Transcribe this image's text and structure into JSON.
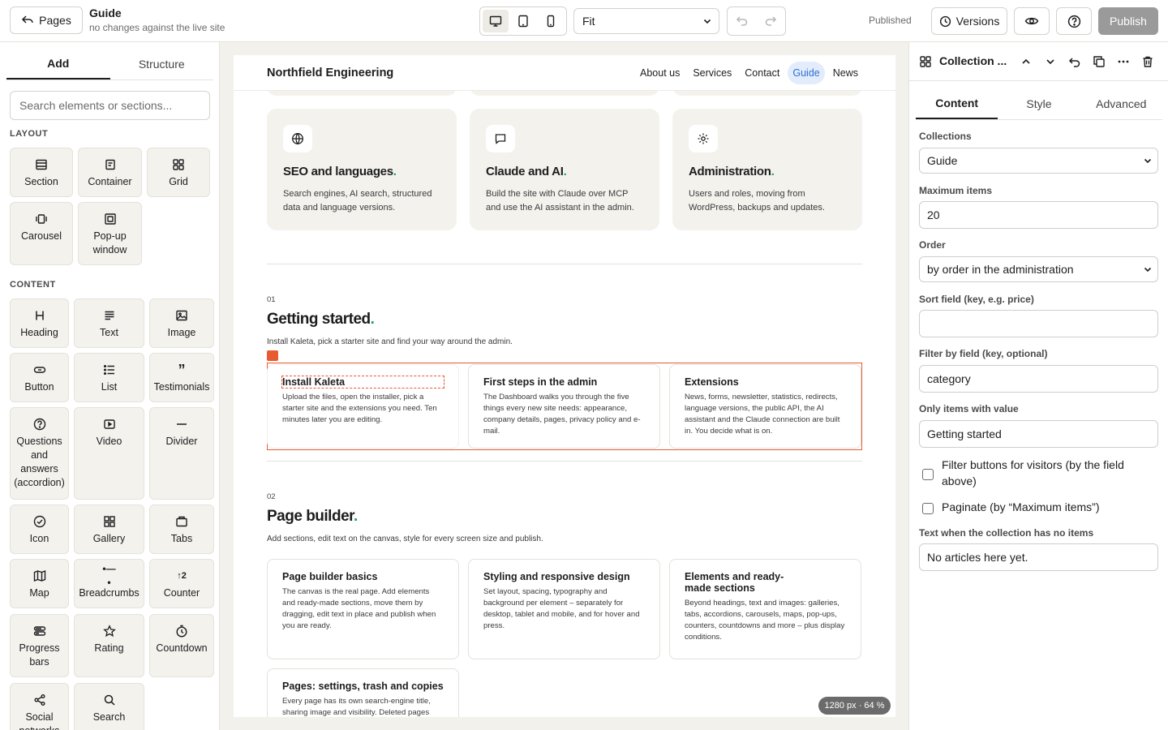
{
  "topbar": {
    "pages_label": "Pages",
    "doc_title": "Guide",
    "doc_status": "no changes against the live site",
    "zoom_value": "Fit",
    "publish_status": "Published",
    "versions_label": "Versions",
    "publish_label": "Publish"
  },
  "left": {
    "tab_add": "Add",
    "tab_structure": "Structure",
    "search_placeholder": "Search elements or sections...",
    "layout_label": "LAYOUT",
    "content_label": "CONTENT",
    "layout_items": [
      "Section",
      "Container",
      "Grid",
      "Carousel",
      "Pop-up window"
    ],
    "content_items": [
      "Heading",
      "Text",
      "Image",
      "Button",
      "List",
      "Testimonials",
      "Questions and answers (accordion)",
      "Video",
      "Divider",
      "Icon",
      "Gallery",
      "Tabs",
      "Map",
      "Breadcrumbs",
      "Counter",
      "Progress bars",
      "Rating",
      "Countdown",
      "Social networks",
      "Search"
    ]
  },
  "site": {
    "brand": "Northfield Engineering",
    "nav": [
      "About us",
      "Services",
      "Contact",
      "Guide",
      "News"
    ],
    "top_cards": [
      {
        "title": "SEO and languages",
        "text": "Search engines, AI search, structured data and language versions."
      },
      {
        "title": "Claude and AI",
        "text": "Build the site with Claude over MCP and use the AI assistant in the admin."
      },
      {
        "title": "Administration",
        "text": "Users and roles, moving from WordPress, backups and updates."
      }
    ],
    "section1": {
      "num": "01",
      "title": "Getting started",
      "desc": "Install Kaleta, pick a starter site and find your way around the admin.",
      "cards": [
        {
          "title": "Install Kaleta",
          "text": "Upload the files, open the installer, pick a starter site and the extensions you need. Ten minutes later you are editing."
        },
        {
          "title": "First steps in the admin",
          "text": "The Dashboard walks you through the five things every new site needs: appearance, company details, pages, privacy policy and e-mail."
        },
        {
          "title": "Extensions",
          "text": "News, forms, newsletter, statistics, redirects, language versions, the public API, the AI assistant and the Claude connection are built in. You decide what is on."
        }
      ]
    },
    "section2": {
      "num": "02",
      "title": "Page builder",
      "desc": "Add sections, edit text on the canvas, style for every screen size and publish.",
      "cards": [
        {
          "title": "Page builder basics",
          "text": "The canvas is the real page. Add elements and ready-made sections, move them by dragging, edit text in place and publish when you are ready."
        },
        {
          "title": "Styling and responsive design",
          "text": "Set layout, spacing, typography and background per element – separately for desktop, tablet and mobile, and for hover and press."
        },
        {
          "title": "Elements and ready-made sections",
          "text": "Beyond headings, text and images: galleries, tabs, accordions, carousels, maps, pop-ups, counters, countdowns and more – plus display conditions."
        },
        {
          "title": "Pages: settings, trash and copies",
          "text": "Every page has its own search-engine title, sharing image and visibility. Deleted pages"
        }
      ]
    },
    "viewport_info": "1280 px · 64 %"
  },
  "right": {
    "title": "Collection ...",
    "tab_content": "Content",
    "tab_style": "Style",
    "tab_advanced": "Advanced",
    "collections_label": "Collections",
    "collections_value": "Guide",
    "max_items_label": "Maximum items",
    "max_items_value": "20",
    "order_label": "Order",
    "order_value": "by order in the administration",
    "sort_field_label": "Sort field (key, e.g. price)",
    "sort_field_value": "",
    "filter_field_label": "Filter by field (key, optional)",
    "filter_field_value": "category",
    "only_items_label": "Only items with value",
    "only_items_value": "Getting started",
    "filter_buttons_label": "Filter buttons for visitors (by the field above)",
    "filter_buttons_checked": false,
    "paginate_label": "Paginate (by “Maximum items”)",
    "paginate_checked": false,
    "empty_text_label": "Text when the collection has no items",
    "empty_text_value": "No articles here yet."
  },
  "colors": {
    "accent_dot": "#1f9d6b",
    "selection": "#e85a2f",
    "nav_active_bg": "#e3ecfb",
    "nav_active_text": "#2f6fd6",
    "publish_disabled": "#9a9a9a"
  }
}
